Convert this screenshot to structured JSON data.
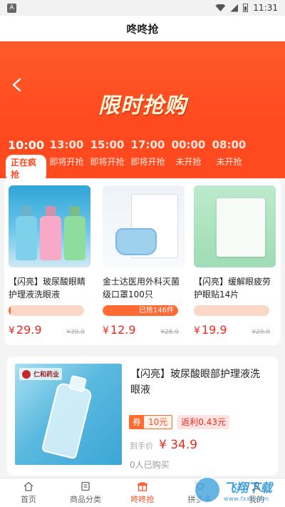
{
  "status_bar": {
    "badge": "A",
    "time": "11:31"
  },
  "header": {
    "title": "咚咚抢"
  },
  "hero": {
    "title": "限时抢购"
  },
  "time_tabs": [
    {
      "time": "10:00",
      "status": "正在疯抢",
      "active": true
    },
    {
      "time": "13:00",
      "status": "即将开抢",
      "active": false
    },
    {
      "time": "15:00",
      "status": "即将开抢",
      "active": false
    },
    {
      "time": "17:00",
      "status": "即将开抢",
      "active": false
    },
    {
      "time": "00:00",
      "status": "未开抢",
      "active": false
    },
    {
      "time": "08:00",
      "status": "未开抢",
      "active": false
    }
  ],
  "carousel": [
    {
      "name": "【闪亮】玻尿酸眼睛护理液洗眼液",
      "bar_text": "",
      "progress": 0.03,
      "currency": "¥",
      "price": "29.9",
      "original": "¥39.9"
    },
    {
      "name": "金士达医用外科灭菌级口罩100只",
      "bar_text": "已抢146件",
      "progress": 1.0,
      "currency": "¥",
      "price": "12.9",
      "original": "¥28.9"
    },
    {
      "name": "【闪亮】缓解眼疲劳护眼贴14片",
      "bar_text": "",
      "progress": 0.0,
      "currency": "¥",
      "price": "19.9",
      "original": "¥29.9"
    }
  ],
  "list": [
    {
      "brand": "仁和药业",
      "name": "【闪亮】玻尿酸眼部护理液洗眼液",
      "coupon_label": "券",
      "coupon_value": "10元",
      "rebate": "返利0.43元",
      "final_label": "到手价",
      "final_price": "¥ 34.9",
      "sold": "0人已购买"
    }
  ],
  "bottom_nav": [
    {
      "label": "首页",
      "icon": "home-icon",
      "active": false
    },
    {
      "label": "商品分类",
      "icon": "category-icon",
      "active": false
    },
    {
      "label": "咚咚抢",
      "icon": "gift-icon",
      "active": true
    },
    {
      "label": "拼多多",
      "icon": "cart-icon",
      "active": false
    },
    {
      "label": "我的",
      "icon": "user-icon",
      "active": false
    }
  ],
  "watermark": {
    "title": "飞翔下载",
    "url": "www.fxxz.com"
  },
  "colors": {
    "accent": "#ff4a1f",
    "price": "#f0281e",
    "bar_bg": "#fbd7c7",
    "bar_fill": "#ff6a35"
  }
}
